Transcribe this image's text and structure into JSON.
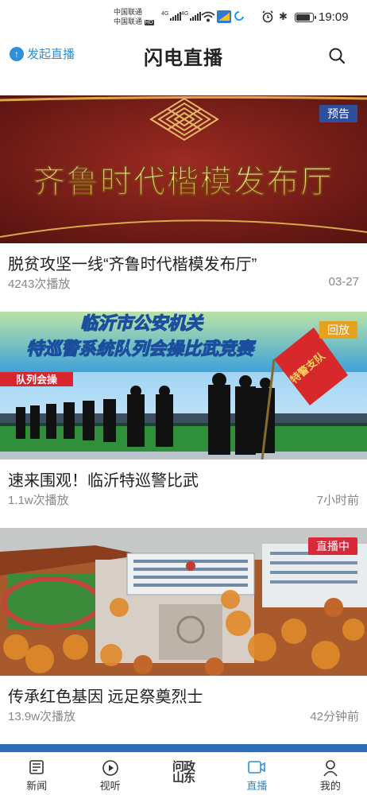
{
  "status_bar": {
    "carrier_1": "中国联通",
    "carrier_2": "中国联通",
    "net_1": "4G",
    "net_2": "4G",
    "hd": "HD",
    "time": "19:09"
  },
  "header": {
    "start_live_label": "发起直播",
    "title": "闪电直播"
  },
  "feed": [
    {
      "badge": "预告",
      "badge_color": "#2d4f9e",
      "banner_text": "齐鲁时代楷模发布厅",
      "title": "脱贫攻坚一线“齐鲁时代楷模发布厅”",
      "views": "4243次播放",
      "time": "03-27"
    },
    {
      "badge": "回放",
      "badge_color": "#e6a11f",
      "banner_line_1": "临沂市公安机关",
      "banner_line_2": "特巡警系统队列会操比武竞赛",
      "banner_tag": "队列会操",
      "flag_text": "特警支队",
      "title": "速来围观！临沂特巡警比武",
      "views": "1.1w次播放",
      "time": "7小时前"
    },
    {
      "badge": "直播中",
      "badge_color": "#d8283a",
      "title": "传承红色基因 远足祭奠烈士",
      "views": "13.9w次播放",
      "time": "42分钟前"
    }
  ],
  "bottom_nav": [
    {
      "label": "新闻",
      "icon": "news-icon"
    },
    {
      "label": "视听",
      "icon": "play-icon"
    },
    {
      "label": "问政\n山东",
      "icon": "wenzheng-logo"
    },
    {
      "label": "直播",
      "icon": "live-icon",
      "active": true
    },
    {
      "label": "我的",
      "icon": "profile-icon"
    }
  ],
  "colors": {
    "accent": "#2f8fd8",
    "text_primary": "#222222",
    "text_secondary": "#888888"
  }
}
